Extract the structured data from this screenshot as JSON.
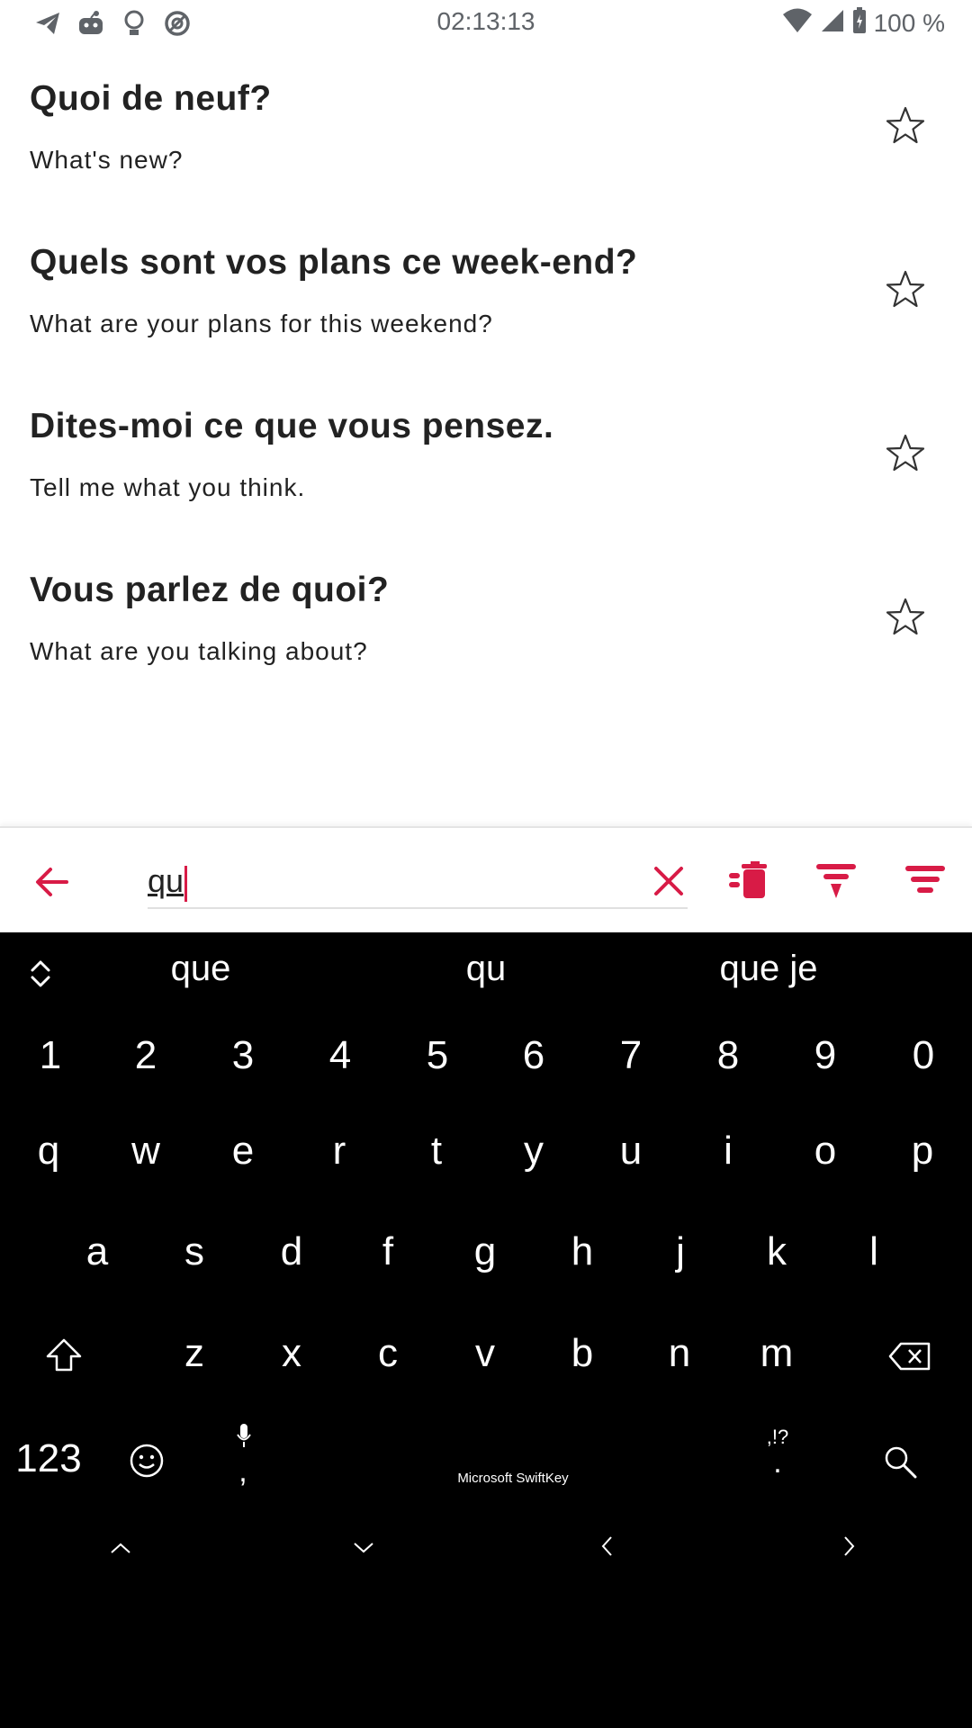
{
  "status_bar": {
    "time": "02:13:13",
    "battery": "100 %",
    "icons": [
      "telegram-icon",
      "reddit-icon",
      "lightbulb-icon",
      "vpn-icon",
      "wifi-icon",
      "signal-icon",
      "battery-icon"
    ]
  },
  "phrases": [
    {
      "french": "Quoi de neuf?",
      "english": "What's new?"
    },
    {
      "french": "Quels sont vos plans ce week-end?",
      "english": "What are your plans for this weekend?"
    },
    {
      "french": "Dites-moi ce que vous pensez.",
      "english": "Tell me what you think."
    },
    {
      "french": "Vous parlez de quoi?",
      "english": "What are you talking about?"
    }
  ],
  "search": {
    "value": "qu",
    "accent_color": "#d81b46"
  },
  "keyboard": {
    "suggestions": [
      "que",
      "qu",
      "que je"
    ],
    "numbers": [
      "1",
      "2",
      "3",
      "4",
      "5",
      "6",
      "7",
      "8",
      "9",
      "0"
    ],
    "row1": [
      "q",
      "w",
      "e",
      "r",
      "t",
      "y",
      "u",
      "i",
      "o",
      "p"
    ],
    "row2": [
      "a",
      "s",
      "d",
      "f",
      "g",
      "h",
      "j",
      "k",
      "l"
    ],
    "row3": [
      "z",
      "x",
      "c",
      "v",
      "b",
      "n",
      "m"
    ],
    "num_key": "123",
    "comma_key": ",",
    "period_key": ".",
    "punct_hint": ",!?",
    "brand": "Microsoft SwiftKey"
  }
}
